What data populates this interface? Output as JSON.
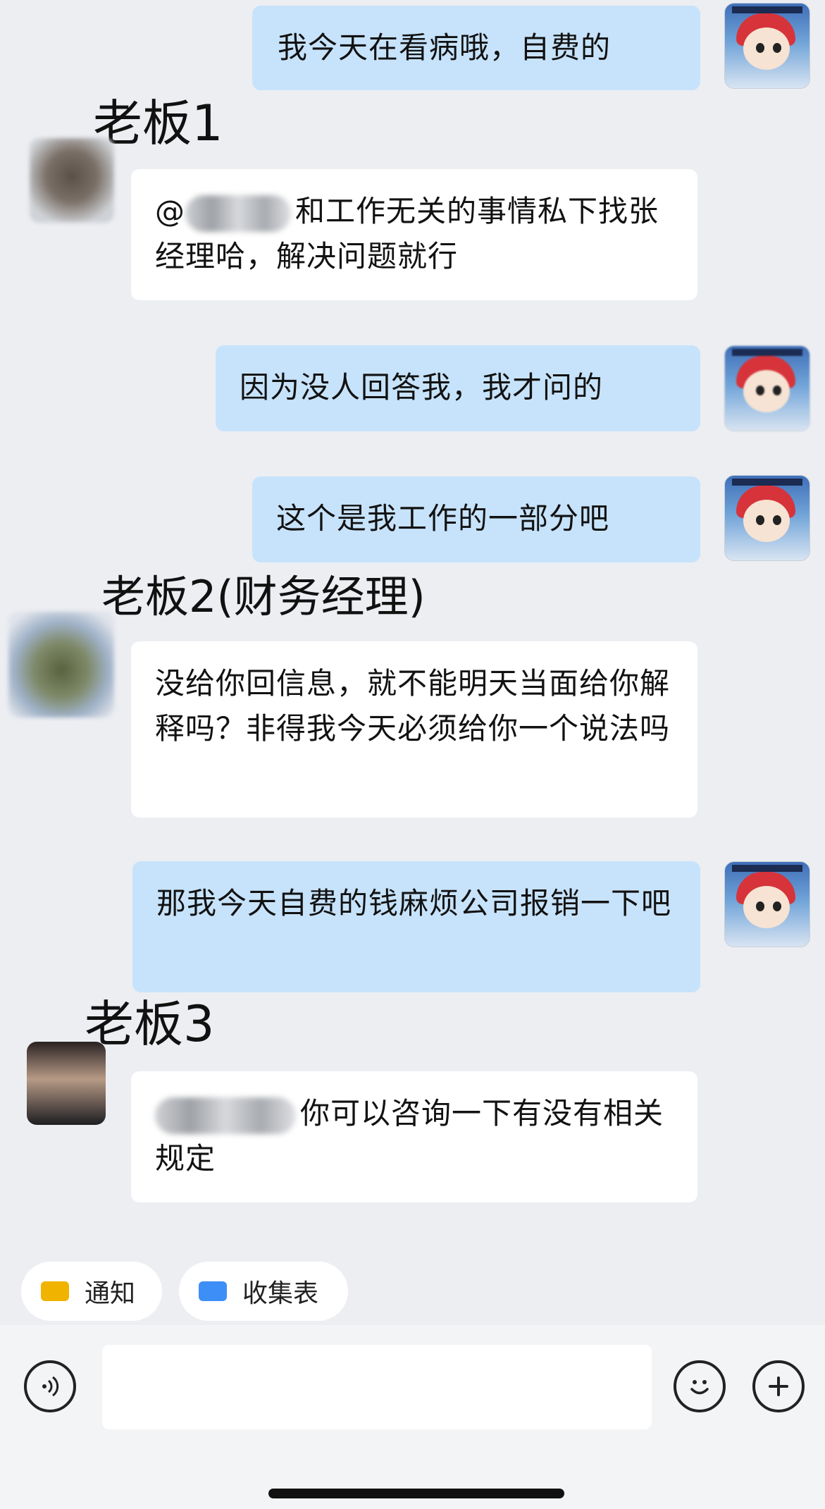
{
  "messages": [
    {
      "text": "我今天在看病哦，自费的"
    },
    {
      "sender": "老板1",
      "mention_label": "@",
      "text": "和工作无关的事情私下找张经理哈，解决问题就行"
    },
    {
      "text": "因为没人回答我，我才问的"
    },
    {
      "text": "这个是我工作的一部分吧"
    },
    {
      "sender": "老板2(财务经理)",
      "text": "没给你回信息，就不能明天当面给你解释吗？非得我今天必须给你一个说法吗"
    },
    {
      "text": "那我今天自费的钱麻烦公司报销一下吧"
    },
    {
      "sender": "老板3",
      "text": "你可以咨询一下有没有相关规定"
    }
  ],
  "quick_actions": [
    {
      "label": "通知",
      "icon": "notice-icon",
      "color": "#f0b400"
    },
    {
      "label": "收集表",
      "icon": "form-icon",
      "color": "#3e8ef7"
    }
  ],
  "input": {
    "placeholder": ""
  },
  "icons": {
    "voice": "voice-icon",
    "emoji": "emoji-icon",
    "add": "plus-icon"
  },
  "colors": {
    "outgoing_bubble": "#c7e3fb",
    "incoming_bubble": "#ffffff",
    "background": "#eceef2"
  }
}
